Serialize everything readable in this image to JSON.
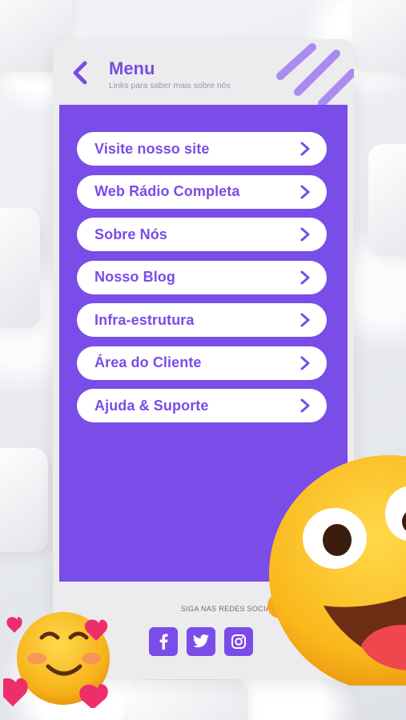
{
  "header": {
    "title": "Menu",
    "subtitle": "Links para saber mais sobre nós"
  },
  "menu": {
    "items": [
      {
        "label": "Visite nosso site"
      },
      {
        "label": "Web Rádio Completa"
      },
      {
        "label": "Sobre Nós"
      },
      {
        "label": "Nosso Blog"
      },
      {
        "label": "Infra-estrutura"
      },
      {
        "label": "Área do Cliente"
      },
      {
        "label": "Ajuda & Suporte"
      }
    ]
  },
  "footer": {
    "social_caption": "SIGA NAS REDES SOCIAIS:",
    "icons": [
      "facebook-icon",
      "twitter-icon",
      "instagram-icon"
    ]
  },
  "colors": {
    "accent": "#7a4ce8",
    "panel": "#ececee",
    "item_bg": "#ffffff"
  }
}
